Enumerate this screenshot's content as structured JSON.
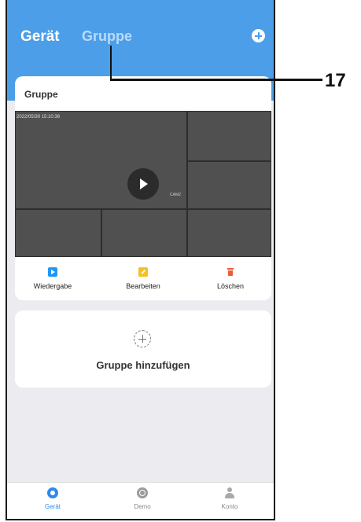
{
  "header": {
    "tab_device": "Gerät",
    "tab_group": "Gruppe",
    "add_icon": "plus-circle-icon",
    "background_color": "#4c9ee8"
  },
  "group_card": {
    "title": "Gruppe",
    "preview": {
      "timestamp": "2022/05/30  15:10:36",
      "camera_label": "CAM2"
    },
    "actions": [
      {
        "label": "Wiedergabe",
        "icon": "playback-icon",
        "color": "#2196f3"
      },
      {
        "label": "Bearbeiten",
        "icon": "edit-icon",
        "color": "#f6c025"
      },
      {
        "label": "Löschen",
        "icon": "trash-icon",
        "color": "#f05a3a"
      }
    ]
  },
  "add_group": {
    "icon": "add-circle-dashed-icon",
    "label": "Gruppe hinzufügen"
  },
  "bottom_nav": {
    "items": [
      {
        "label": "Gerät",
        "icon": "device-icon",
        "active": true
      },
      {
        "label": "Demo",
        "icon": "demo-icon",
        "active": false
      },
      {
        "label": "Konto",
        "icon": "account-icon",
        "active": false
      }
    ],
    "active_color": "#2f8be6"
  },
  "annotation": {
    "callout_number": "17"
  }
}
